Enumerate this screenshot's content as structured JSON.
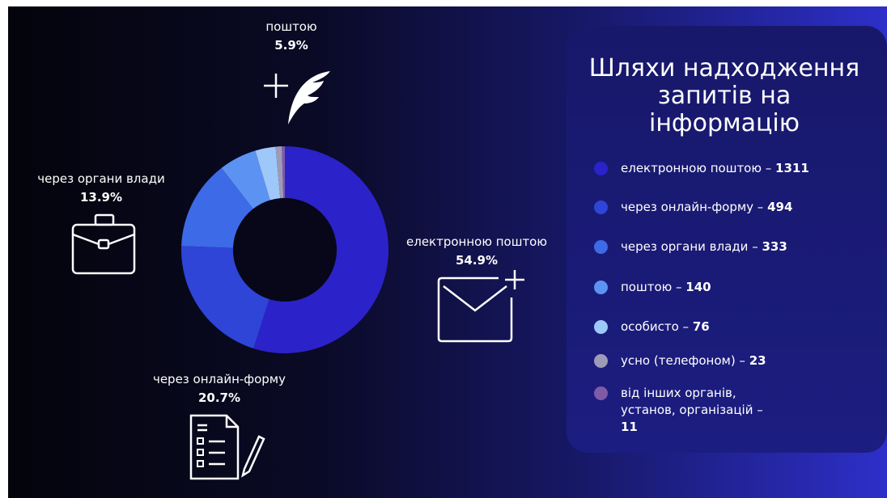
{
  "chart_data": {
    "type": "pie",
    "title": "Шляхи надходження запитів на інформацію",
    "categories": [
      "електронною поштою",
      "через онлайн-форму",
      "через органи влади",
      "поштою",
      "особисто",
      "усно (телефоном)",
      "від інших органів, установ, організацій"
    ],
    "values": [
      1311,
      494,
      333,
      140,
      76,
      23,
      11
    ],
    "colors": [
      "#2c22c9",
      "#2e45d8",
      "#3d6ae6",
      "#5c93f2",
      "#9ec7fa",
      "#9e9ab8",
      "#7e5aa8"
    ]
  },
  "callouts": {
    "post": {
      "name": "поштою",
      "pct": "5.9%",
      "icon": "quill-plus-icon"
    },
    "authorities": {
      "name": "через органи влади",
      "pct": "13.9%",
      "icon": "briefcase-icon"
    },
    "email": {
      "name": "електронною поштою",
      "pct": "54.9%",
      "icon": "envelope-plus-icon"
    },
    "online_form": {
      "name": "через онлайн-форму",
      "pct": "20.7%",
      "icon": "form-pencil-icon"
    }
  },
  "legend": {
    "title": "Шляхи надходження\nзапитів на\nінформацію",
    "items": [
      {
        "label": "електронною поштою – ",
        "value": "1311",
        "color": "#2c22c9"
      },
      {
        "label": "через онлайн-форму – ",
        "value": "494",
        "color": "#2e45d8"
      },
      {
        "label": "через органи влади – ",
        "value": "333",
        "color": "#3d6ae6"
      },
      {
        "label": "поштою – ",
        "value": "140",
        "color": "#5c93f2"
      },
      {
        "label": "особисто – ",
        "value": "76",
        "color": "#9ec7fa"
      },
      {
        "label": "усно (телефоном) – ",
        "value": "23",
        "color": "#9e9ab8"
      },
      {
        "label": "від інших органів,\nустанов, організацій –\n",
        "value": "11",
        "color": "#7e5aa8"
      }
    ]
  }
}
